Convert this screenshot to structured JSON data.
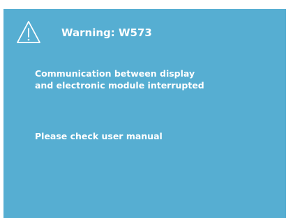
{
  "warning": {
    "icon": "warning-triangle-icon",
    "title": "Warning: W573"
  },
  "message": {
    "line1": "Communication between display",
    "line2": "and electronic module interrupted"
  },
  "instruction": "Please check user manual",
  "colors": {
    "panel_background": "#56aed2",
    "text": "#ffffff"
  }
}
